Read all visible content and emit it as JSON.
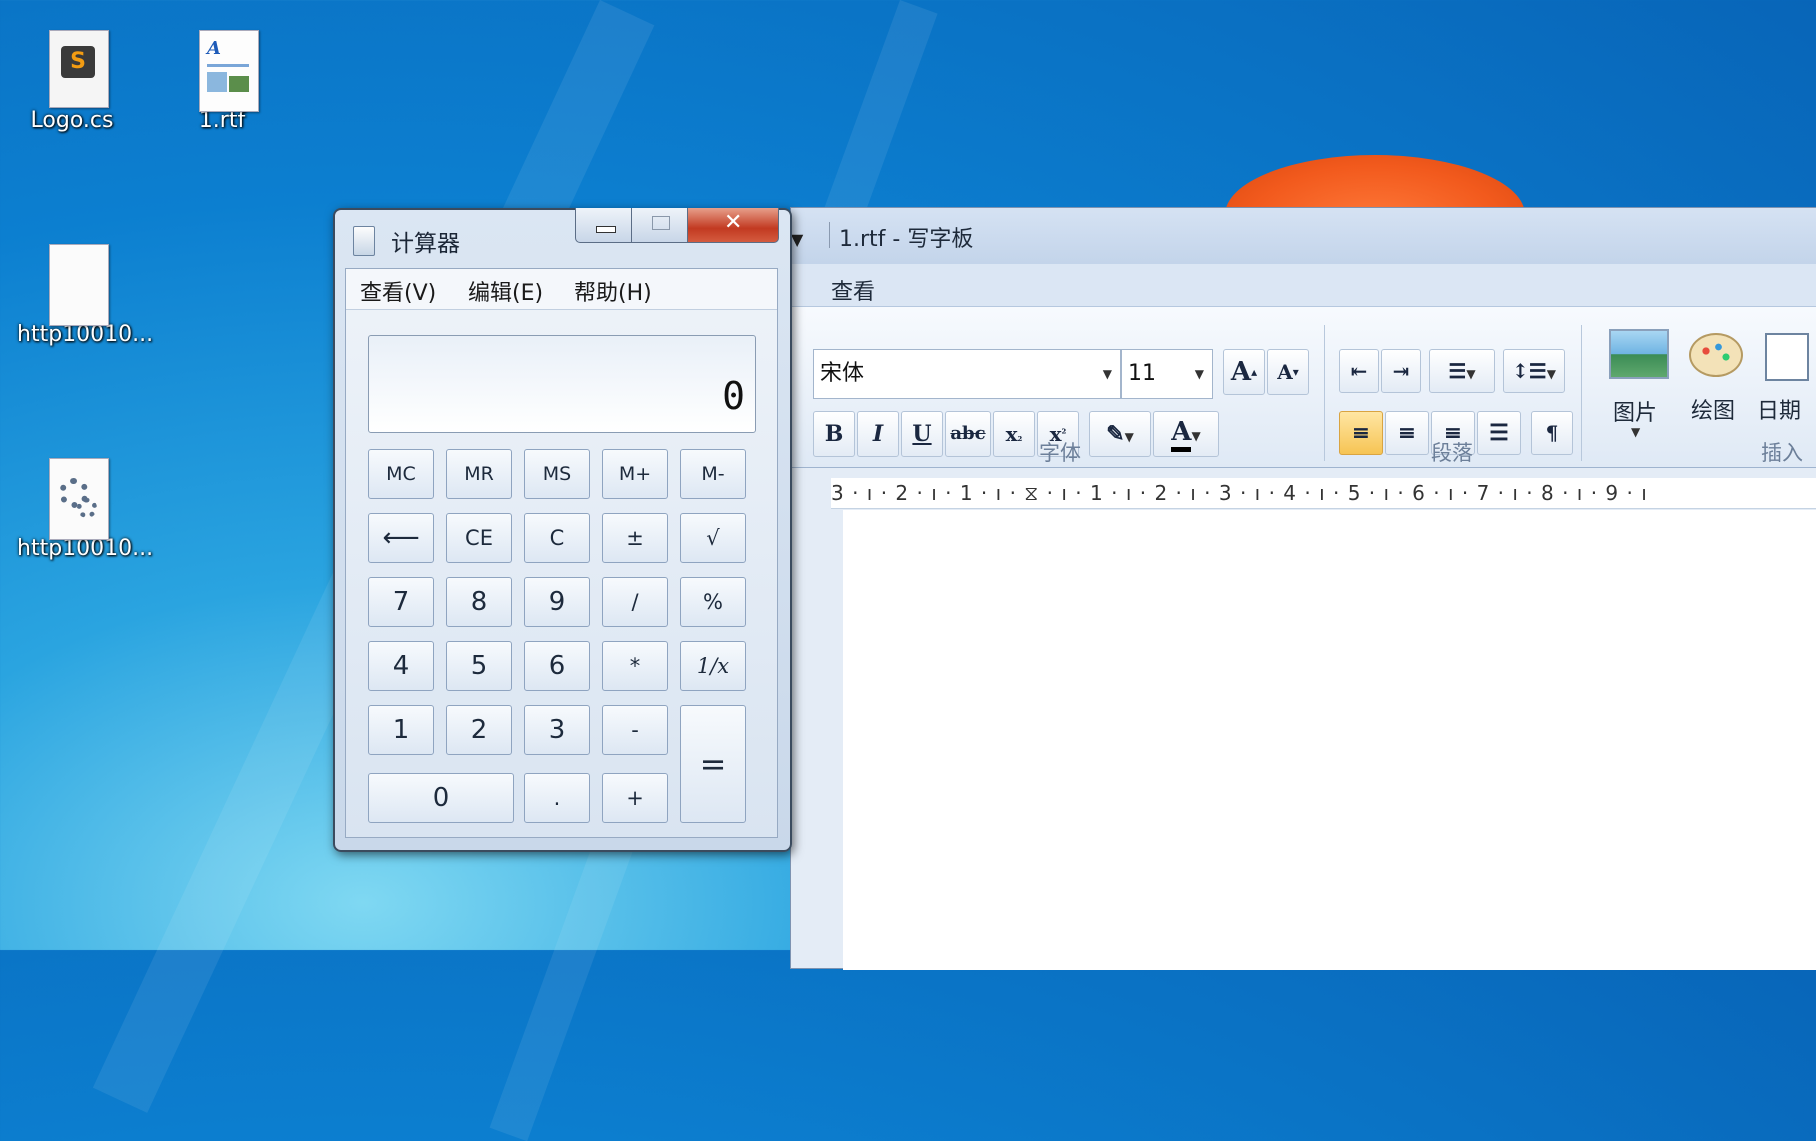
{
  "desktop": {
    "icons": [
      {
        "label": "Logo.cs"
      },
      {
        "label": "1.rtf"
      },
      {
        "label": "http10010..."
      },
      {
        "label": "http10010..."
      }
    ]
  },
  "wordpad": {
    "title": "1.rtf - 写字板",
    "tab_view": "查看",
    "font_name": "宋体",
    "font_size": "11",
    "group_font": "字体",
    "group_paragraph": "段落",
    "group_insert": "插入",
    "insert_picture": "图片",
    "insert_paint": "绘图",
    "insert_date": "日期",
    "ruler": "3 · ı · 2 · ı · 1 · ı · ⧖ · ı · 1 · ı · 2 · ı · 3 · ı · 4 · ı · 5 · ı · 6 · ı · 7 · ı · 8 · ı · 9 · ı"
  },
  "calculator": {
    "title": "计算器",
    "menu": [
      "查看(V)",
      "编辑(E)",
      "帮助(H)"
    ],
    "display": "0",
    "buttons": {
      "mc": "MC",
      "mr": "MR",
      "ms": "MS",
      "mplus": "M+",
      "mminus": "M-",
      "back": "⟵",
      "ce": "CE",
      "c": "C",
      "plusminus": "±",
      "sqrt": "√",
      "n7": "7",
      "n8": "8",
      "n9": "9",
      "div": "/",
      "pct": "%",
      "n4": "4",
      "n5": "5",
      "n6": "6",
      "mul": "*",
      "recip": "1/x",
      "n1": "1",
      "n2": "2",
      "n3": "3",
      "sub": "-",
      "eq": "=",
      "n0": "0",
      "dot": ".",
      "add": "+"
    }
  }
}
